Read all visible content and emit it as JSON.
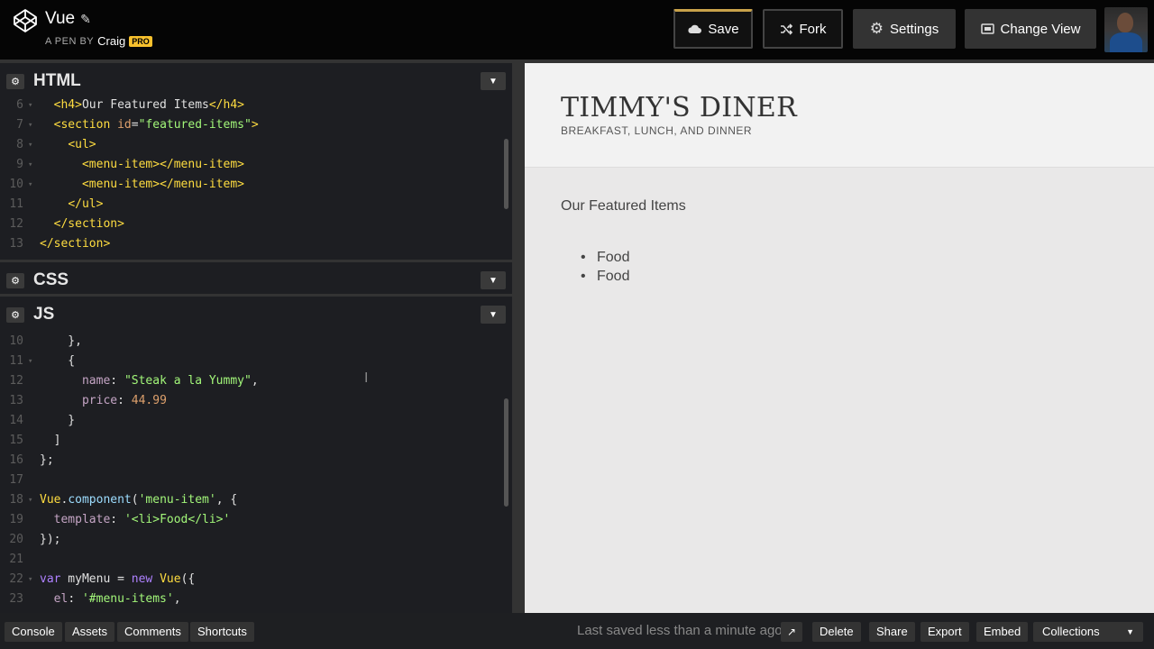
{
  "header": {
    "title": "Vue",
    "by_label": "A PEN BY",
    "author": "Craig",
    "badge": "PRO",
    "buttons": {
      "save": "Save",
      "fork": "Fork",
      "settings": "Settings",
      "change_view": "Change View"
    }
  },
  "panels": {
    "html": {
      "title": "HTML"
    },
    "css": {
      "title": "CSS"
    },
    "js": {
      "title": "JS"
    }
  },
  "html_code": [
    {
      "n": "6",
      "fold": "▾",
      "text": "  <h4>Our Featured Items</h4>"
    },
    {
      "n": "7",
      "fold": "▾",
      "text": "  <section id=\"featured-items\">"
    },
    {
      "n": "8",
      "fold": "▾",
      "text": "    <ul>"
    },
    {
      "n": "9",
      "fold": "▾",
      "text": "      <menu-item></menu-item>"
    },
    {
      "n": "10",
      "fold": "▾",
      "text": "      <menu-item></menu-item>"
    },
    {
      "n": "11",
      "fold": "",
      "text": "    </ul>"
    },
    {
      "n": "12",
      "fold": "",
      "text": "  </section>"
    },
    {
      "n": "13",
      "fold": "",
      "text": "</section>"
    }
  ],
  "js_code": [
    {
      "n": "10",
      "fold": "",
      "text": "    },"
    },
    {
      "n": "11",
      "fold": "▾",
      "text": "    {"
    },
    {
      "n": "12",
      "fold": "",
      "text": "      name: \"Steak a la Yummy\","
    },
    {
      "n": "13",
      "fold": "",
      "text": "      price: 44.99"
    },
    {
      "n": "14",
      "fold": "",
      "text": "    }"
    },
    {
      "n": "15",
      "fold": "",
      "text": "  ]"
    },
    {
      "n": "16",
      "fold": "",
      "text": "};"
    },
    {
      "n": "17",
      "fold": "",
      "text": ""
    },
    {
      "n": "18",
      "fold": "▾",
      "text": "Vue.component('menu-item', {"
    },
    {
      "n": "19",
      "fold": "",
      "text": "  template: '<li>Food</li>'"
    },
    {
      "n": "20",
      "fold": "",
      "text": "});"
    },
    {
      "n": "21",
      "fold": "",
      "text": ""
    },
    {
      "n": "22",
      "fold": "▾",
      "text": "var myMenu = new Vue({"
    },
    {
      "n": "23",
      "fold": "",
      "text": "  el: '#menu-items',"
    }
  ],
  "preview": {
    "title": "TIMMY'S DINER",
    "subtitle": "BREAKFAST, LUNCH, AND DINNER",
    "featured_heading": "Our Featured Items",
    "items": [
      "Food",
      "Food"
    ]
  },
  "footer": {
    "console": "Console",
    "assets": "Assets",
    "comments": "Comments",
    "shortcuts": "Shortcuts",
    "saved_status": "Last saved less than a minute ago",
    "delete": "Delete",
    "share": "Share",
    "export": "Export",
    "embed": "Embed",
    "collections": "Collections"
  },
  "colors": {
    "editor_bg": "#1d1e22",
    "save_accent": "#c9a24a",
    "pro_badge": "#f8c12d"
  }
}
